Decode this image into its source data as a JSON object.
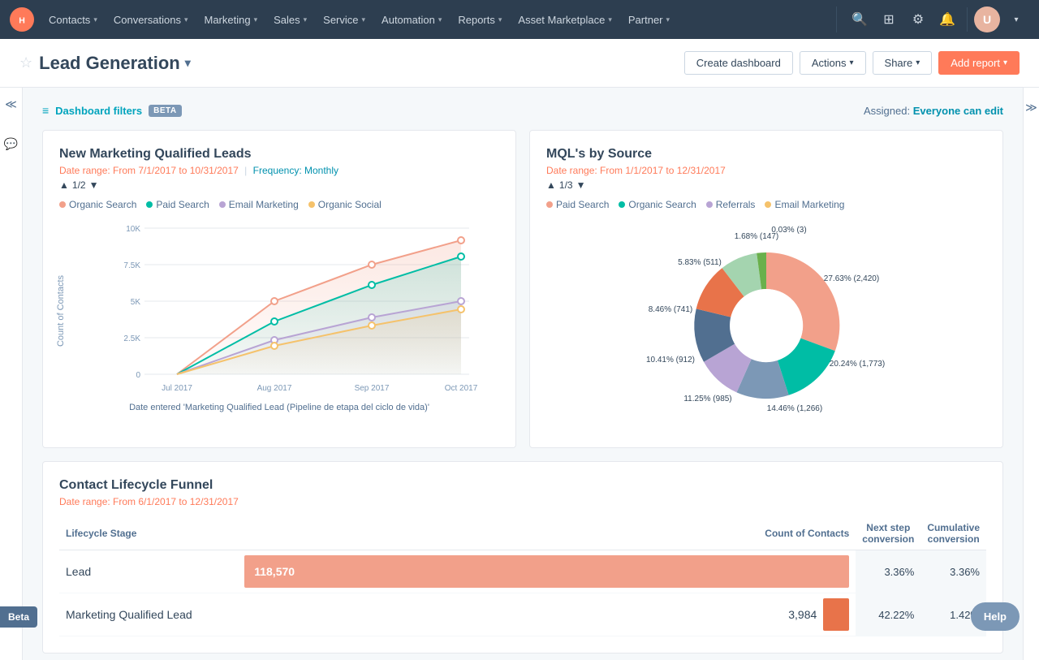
{
  "nav": {
    "logo": "HubSpot",
    "items": [
      {
        "label": "Contacts",
        "has_chevron": true
      },
      {
        "label": "Conversations",
        "has_chevron": true
      },
      {
        "label": "Marketing",
        "has_chevron": true
      },
      {
        "label": "Sales",
        "has_chevron": true
      },
      {
        "label": "Service",
        "has_chevron": true
      },
      {
        "label": "Automation",
        "has_chevron": true
      },
      {
        "label": "Reports",
        "has_chevron": true
      },
      {
        "label": "Asset Marketplace",
        "has_chevron": true
      },
      {
        "label": "Partner",
        "has_chevron": true
      }
    ]
  },
  "subheader": {
    "page_title": "Lead Generation",
    "btn_create_dashboard": "Create dashboard",
    "btn_actions": "Actions",
    "btn_share": "Share",
    "btn_add_report": "Add report"
  },
  "filters": {
    "label": "Dashboard filters",
    "beta": "BETA",
    "assigned_label": "Assigned:",
    "assigned_value": "Everyone can edit"
  },
  "card1": {
    "title": "New Marketing Qualified Leads",
    "date_range": "Date range: From 7/1/2017 to 10/31/2017",
    "frequency": "Frequency: Monthly",
    "page_nav": "1/2",
    "legend": [
      {
        "label": "Organic Search",
        "color": "#f2a08a"
      },
      {
        "label": "Paid Search",
        "color": "#00bda5"
      },
      {
        "label": "Email Marketing",
        "color": "#b8a4d4"
      },
      {
        "label": "Organic Social",
        "color": "#f5c26b"
      }
    ],
    "y_axis_label": "Count of Contacts",
    "x_axis_label": "Date entered 'Marketing Qualified Lead (Pipeline de etapa del ciclo de vida)'",
    "y_ticks": [
      "10K",
      "7.5K",
      "5K",
      "2.5K",
      "0"
    ],
    "x_ticks": [
      "Jul 2017",
      "Aug 2017",
      "Sep 2017",
      "Oct 2017"
    ]
  },
  "card2": {
    "title": "MQL's by Source",
    "date_range": "Date range: From 1/1/2017 to 12/31/2017",
    "page_nav": "1/3",
    "legend": [
      {
        "label": "Paid Search",
        "color": "#f2a08a"
      },
      {
        "label": "Organic Search",
        "color": "#00bda5"
      },
      {
        "label": "Referrals",
        "color": "#b8a4d4"
      },
      {
        "label": "Email Marketing",
        "color": "#f5c26b"
      }
    ],
    "slices": [
      {
        "label": "27.63% (2,420)",
        "color": "#f2a08a",
        "value": 27.63
      },
      {
        "label": "20.24% (1,773)",
        "color": "#00bda5",
        "value": 20.24
      },
      {
        "label": "14.46% (1,266)",
        "color": "#7c98b6",
        "value": 14.46
      },
      {
        "label": "11.25% (985)",
        "color": "#b8a4d4",
        "value": 11.25
      },
      {
        "label": "10.41% (912)",
        "color": "#516f90",
        "value": 10.41
      },
      {
        "label": "8.46% (741)",
        "color": "#e8734a",
        "value": 8.46
      },
      {
        "label": "5.83% (511)",
        "color": "#a4d4af",
        "value": 5.83
      },
      {
        "label": "1.68% (147)",
        "color": "#6ab04c",
        "value": 1.68
      },
      {
        "label": "0.03% (3)",
        "color": "#f5c26b",
        "value": 0.03
      }
    ]
  },
  "card3": {
    "title": "Contact Lifecycle Funnel",
    "date_range": "Date range: From 6/1/2017 to 12/31/2017",
    "col_lifecycle": "Lifecycle Stage",
    "col_count": "Count of Contacts",
    "col_next": "Next step conversion",
    "col_cumulative": "Cumulative conversion",
    "rows": [
      {
        "stage": "Lead",
        "count": "118,570",
        "bar_width": "100%",
        "next": "3.36%",
        "cumulative": "3.36%"
      },
      {
        "stage": "Marketing Qualified Lead",
        "count": "3,984",
        "bar_width": "3.36%",
        "next": "42.22%",
        "cumulative": "1.42%"
      }
    ]
  }
}
